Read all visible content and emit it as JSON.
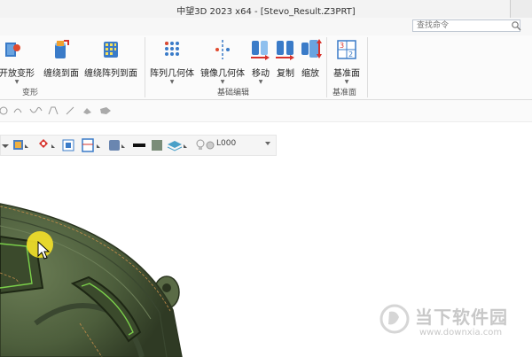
{
  "window": {
    "title": "中望3D 2023 x64 - [Stevo_Result.Z3PRT]"
  },
  "search": {
    "placeholder": "查找命令"
  },
  "ribbon": {
    "buttons": [
      {
        "label": "开放变形",
        "icon": "open-deform-icon"
      },
      {
        "label": "缠绕到面",
        "icon": "wrap-to-face-icon"
      },
      {
        "label": "缠绕阵列到面",
        "icon": "wrap-pattern-to-face-icon"
      },
      {
        "label": "阵列几何体",
        "icon": "pattern-geometry-icon"
      },
      {
        "label": "镜像几何体",
        "icon": "mirror-geometry-icon"
      },
      {
        "label": "移动",
        "icon": "move-icon"
      },
      {
        "label": "复制",
        "icon": "copy-icon"
      },
      {
        "label": "缩放",
        "icon": "scale-icon"
      },
      {
        "label": "基准面",
        "icon": "datum-plane-icon"
      }
    ],
    "groups": [
      "变形",
      "基础编辑",
      "基准面"
    ]
  },
  "viewbar": {
    "layer": "L000"
  },
  "watermark": {
    "title": "当下软件园",
    "url": "www.downxia.com"
  },
  "colors": {
    "part": "#4d5e3c",
    "accent": "#d7322b",
    "highlight": "#f2e02a"
  }
}
